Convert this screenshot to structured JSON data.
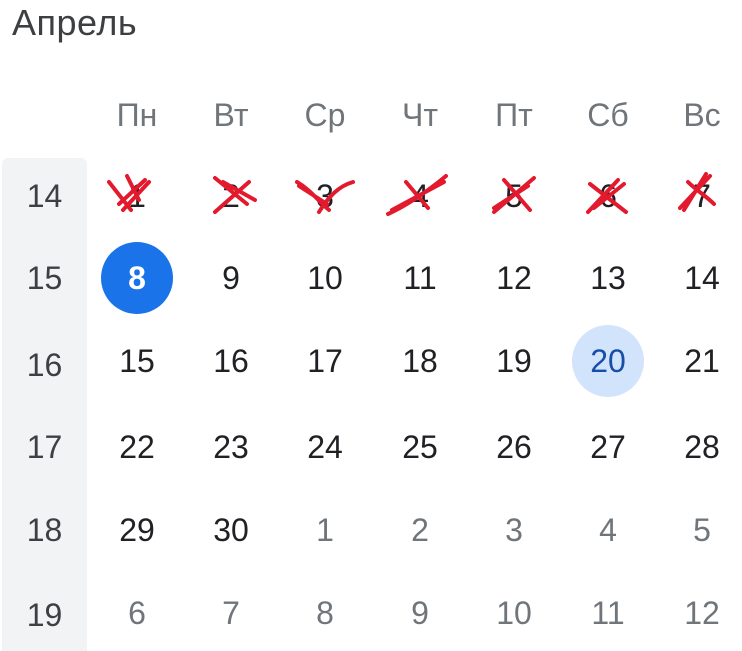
{
  "calendar": {
    "month_title": "Апрель",
    "weekdays": [
      "Пн",
      "Вт",
      "Ср",
      "Чт",
      "Пт",
      "Сб",
      "Вс"
    ],
    "week_numbers": [
      "14",
      "15",
      "16",
      "17",
      "18",
      "19"
    ],
    "weeks": [
      [
        {
          "day": "1",
          "state": "crossed"
        },
        {
          "day": "2",
          "state": "crossed"
        },
        {
          "day": "3",
          "state": "crossed"
        },
        {
          "day": "4",
          "state": "crossed"
        },
        {
          "day": "5",
          "state": "crossed"
        },
        {
          "day": "6",
          "state": "crossed"
        },
        {
          "day": "7",
          "state": "crossed"
        }
      ],
      [
        {
          "day": "8",
          "state": "today"
        },
        {
          "day": "9",
          "state": "normal"
        },
        {
          "day": "10",
          "state": "normal"
        },
        {
          "day": "11",
          "state": "normal"
        },
        {
          "day": "12",
          "state": "normal"
        },
        {
          "day": "13",
          "state": "normal"
        },
        {
          "day": "14",
          "state": "normal"
        }
      ],
      [
        {
          "day": "15",
          "state": "normal"
        },
        {
          "day": "16",
          "state": "normal"
        },
        {
          "day": "17",
          "state": "normal"
        },
        {
          "day": "18",
          "state": "normal"
        },
        {
          "day": "19",
          "state": "normal"
        },
        {
          "day": "20",
          "state": "selected"
        },
        {
          "day": "21",
          "state": "normal"
        }
      ],
      [
        {
          "day": "22",
          "state": "normal"
        },
        {
          "day": "23",
          "state": "normal"
        },
        {
          "day": "24",
          "state": "normal"
        },
        {
          "day": "25",
          "state": "normal"
        },
        {
          "day": "26",
          "state": "normal"
        },
        {
          "day": "27",
          "state": "normal"
        },
        {
          "day": "28",
          "state": "normal"
        }
      ],
      [
        {
          "day": "29",
          "state": "normal"
        },
        {
          "day": "30",
          "state": "normal"
        },
        {
          "day": "1",
          "state": "other-month"
        },
        {
          "day": "2",
          "state": "other-month"
        },
        {
          "day": "3",
          "state": "other-month"
        },
        {
          "day": "4",
          "state": "other-month"
        },
        {
          "day": "5",
          "state": "other-month"
        }
      ],
      [
        {
          "day": "6",
          "state": "other-month"
        },
        {
          "day": "7",
          "state": "other-month"
        },
        {
          "day": "8",
          "state": "other-month"
        },
        {
          "day": "9",
          "state": "other-month"
        },
        {
          "day": "10",
          "state": "other-month"
        },
        {
          "day": "11",
          "state": "other-month"
        },
        {
          "day": "12",
          "state": "other-month"
        }
      ]
    ],
    "colors": {
      "today_bg": "#1a73e8",
      "selected_bg": "#d2e3fc",
      "strike": "#e3192d",
      "week_column_bg": "#f1f3f4"
    },
    "strike_icon": "cross-out-mark"
  }
}
